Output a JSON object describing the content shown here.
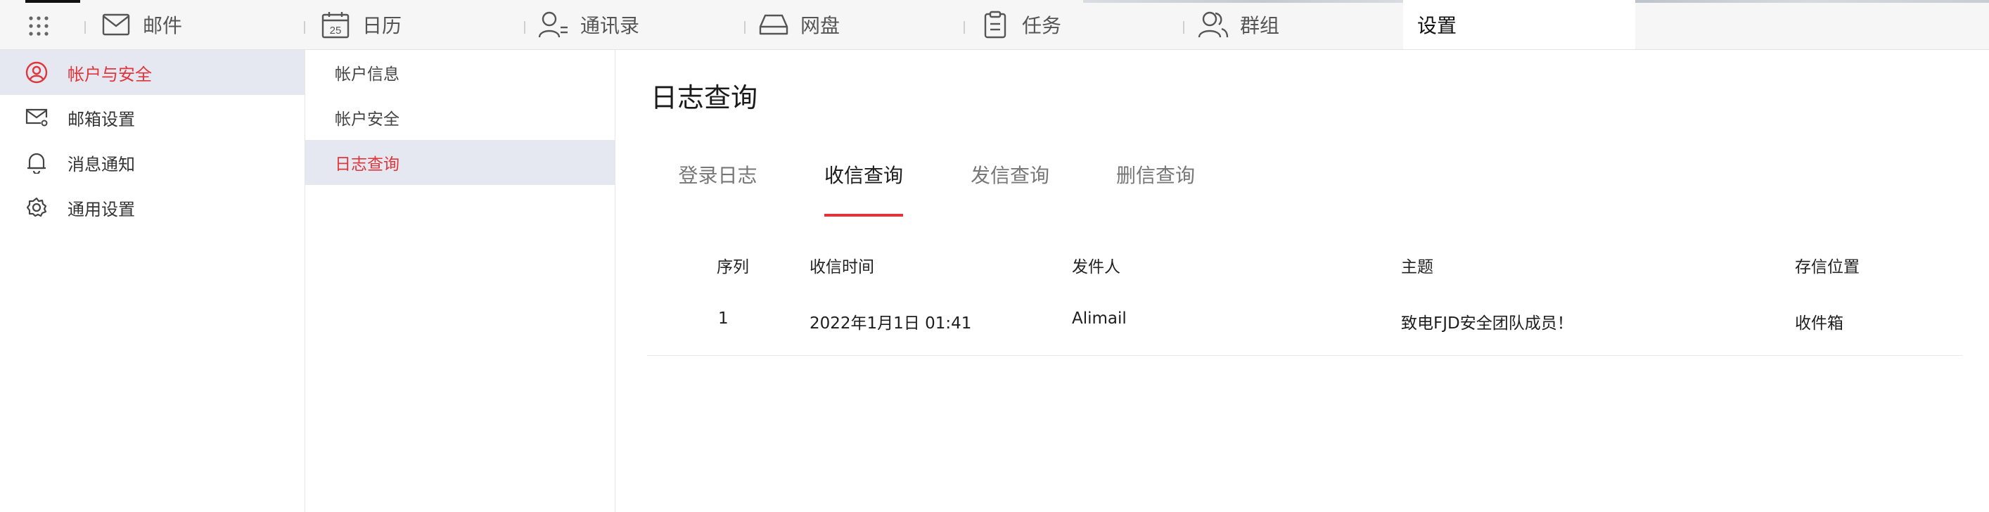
{
  "nav": {
    "items": [
      {
        "label": "邮件",
        "icon": "mail-icon"
      },
      {
        "label": "日历",
        "icon": "calendar-icon",
        "icon_text": "25"
      },
      {
        "label": "通讯录",
        "icon": "contacts-icon"
      },
      {
        "label": "网盘",
        "icon": "drive-icon"
      },
      {
        "label": "任务",
        "icon": "clipboard-icon"
      },
      {
        "label": "群组",
        "icon": "group-icon"
      },
      {
        "label": "设置",
        "icon": "",
        "active": true
      }
    ]
  },
  "sidebar": {
    "items": [
      {
        "label": "帐户与安全",
        "icon": "user-circle-icon",
        "active": true
      },
      {
        "label": "邮箱设置",
        "icon": "mail-settings-icon"
      },
      {
        "label": "消息通知",
        "icon": "bell-icon"
      },
      {
        "label": "通用设置",
        "icon": "gear-icon"
      }
    ]
  },
  "subnav": {
    "items": [
      {
        "label": "帐户信息"
      },
      {
        "label": "帐户安全"
      },
      {
        "label": "日志查询",
        "active": true
      }
    ]
  },
  "main": {
    "title": "日志查询",
    "tabs": [
      {
        "label": "登录日志"
      },
      {
        "label": "收信查询",
        "active": true
      },
      {
        "label": "发信查询"
      },
      {
        "label": "删信查询"
      }
    ],
    "table": {
      "headers": [
        "序列",
        "收信时间",
        "发件人",
        "主题",
        "存信位置"
      ],
      "rows": [
        [
          "1",
          "2022年1月1日 01:41",
          "Alimail",
          "致电FJD安全团队成员！",
          "收件箱"
        ]
      ]
    }
  },
  "colors": {
    "accent": "#e0363b",
    "active_bg": "#e5e8f1",
    "topbar_bg": "#f6f6f6"
  }
}
